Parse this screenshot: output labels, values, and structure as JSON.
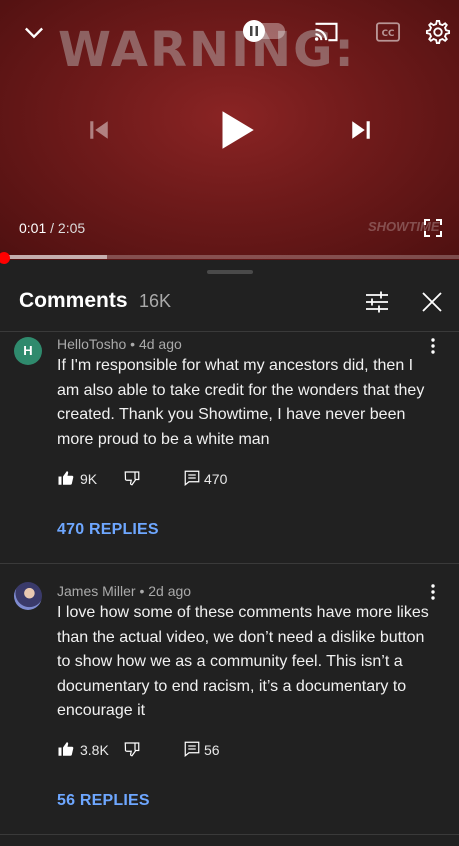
{
  "player": {
    "background_text": "WARNING:",
    "current_time": "0:01",
    "separator": " / ",
    "duration": "2:05",
    "watermark": "SHOWTIME",
    "progress_fraction": 0.004,
    "buffer_fraction": 0.233
  },
  "comments_header": {
    "title": "Comments",
    "count": "16K"
  },
  "comments": [
    {
      "avatar_letter": "H",
      "author": "HelloTosho",
      "time": "4d ago",
      "text": "If I'm responsible for what my ancestors did, then I am also able to take credit for the wonders that they created. Thank you Showtime, I have never been more proud to be a white man",
      "likes": "9K",
      "reply_count": "470",
      "replies_label": "470 REPLIES"
    },
    {
      "author": "James Miller",
      "time": "2d ago",
      "text": "I love how some of these comments have more likes than the actual video, we don’t need a dislike button to show how we as a community feel. This isn’t a documentary to end racism, it’s a documentary to encourage it",
      "likes": "3.8K",
      "reply_count": "56",
      "replies_label": "56 REPLIES"
    }
  ],
  "meta_separator": " • ",
  "colors": {
    "background": "#212121",
    "player": "#6e1a1a",
    "accent_link": "#6ea7ff",
    "progress": "#ff0000",
    "avatar_h": "#2f8a6d"
  },
  "icons": [
    "chevron-down-icon",
    "pause-toggle-icon",
    "cast-icon",
    "captions-icon",
    "settings-icon",
    "skip-previous-icon",
    "play-icon",
    "skip-next-icon",
    "fullscreen-icon",
    "filter-icon",
    "close-icon",
    "more-vert-icon",
    "thumb-up-icon",
    "thumb-down-icon",
    "reply-icon"
  ]
}
